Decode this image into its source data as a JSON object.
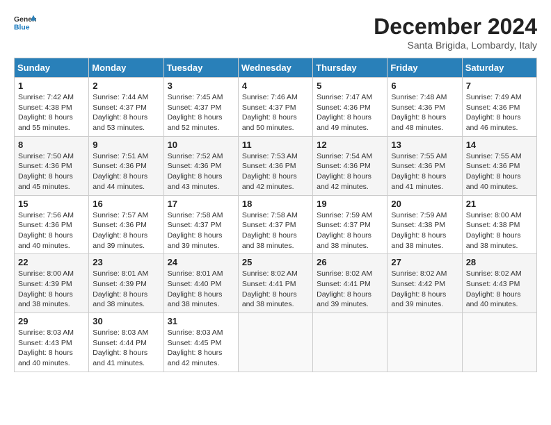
{
  "header": {
    "logo_line1": "General",
    "logo_line2": "Blue",
    "month_year": "December 2024",
    "location": "Santa Brigida, Lombardy, Italy"
  },
  "days_of_week": [
    "Sunday",
    "Monday",
    "Tuesday",
    "Wednesday",
    "Thursday",
    "Friday",
    "Saturday"
  ],
  "weeks": [
    [
      {
        "day": "1",
        "sunrise": "7:42 AM",
        "sunset": "4:38 PM",
        "daylight": "8 hours and 55 minutes."
      },
      {
        "day": "2",
        "sunrise": "7:44 AM",
        "sunset": "4:37 PM",
        "daylight": "8 hours and 53 minutes."
      },
      {
        "day": "3",
        "sunrise": "7:45 AM",
        "sunset": "4:37 PM",
        "daylight": "8 hours and 52 minutes."
      },
      {
        "day": "4",
        "sunrise": "7:46 AM",
        "sunset": "4:37 PM",
        "daylight": "8 hours and 50 minutes."
      },
      {
        "day": "5",
        "sunrise": "7:47 AM",
        "sunset": "4:36 PM",
        "daylight": "8 hours and 49 minutes."
      },
      {
        "day": "6",
        "sunrise": "7:48 AM",
        "sunset": "4:36 PM",
        "daylight": "8 hours and 48 minutes."
      },
      {
        "day": "7",
        "sunrise": "7:49 AM",
        "sunset": "4:36 PM",
        "daylight": "8 hours and 46 minutes."
      }
    ],
    [
      {
        "day": "8",
        "sunrise": "7:50 AM",
        "sunset": "4:36 PM",
        "daylight": "8 hours and 45 minutes."
      },
      {
        "day": "9",
        "sunrise": "7:51 AM",
        "sunset": "4:36 PM",
        "daylight": "8 hours and 44 minutes."
      },
      {
        "day": "10",
        "sunrise": "7:52 AM",
        "sunset": "4:36 PM",
        "daylight": "8 hours and 43 minutes."
      },
      {
        "day": "11",
        "sunrise": "7:53 AM",
        "sunset": "4:36 PM",
        "daylight": "8 hours and 42 minutes."
      },
      {
        "day": "12",
        "sunrise": "7:54 AM",
        "sunset": "4:36 PM",
        "daylight": "8 hours and 42 minutes."
      },
      {
        "day": "13",
        "sunrise": "7:55 AM",
        "sunset": "4:36 PM",
        "daylight": "8 hours and 41 minutes."
      },
      {
        "day": "14",
        "sunrise": "7:55 AM",
        "sunset": "4:36 PM",
        "daylight": "8 hours and 40 minutes."
      }
    ],
    [
      {
        "day": "15",
        "sunrise": "7:56 AM",
        "sunset": "4:36 PM",
        "daylight": "8 hours and 40 minutes."
      },
      {
        "day": "16",
        "sunrise": "7:57 AM",
        "sunset": "4:36 PM",
        "daylight": "8 hours and 39 minutes."
      },
      {
        "day": "17",
        "sunrise": "7:58 AM",
        "sunset": "4:37 PM",
        "daylight": "8 hours and 39 minutes."
      },
      {
        "day": "18",
        "sunrise": "7:58 AM",
        "sunset": "4:37 PM",
        "daylight": "8 hours and 38 minutes."
      },
      {
        "day": "19",
        "sunrise": "7:59 AM",
        "sunset": "4:37 PM",
        "daylight": "8 hours and 38 minutes."
      },
      {
        "day": "20",
        "sunrise": "7:59 AM",
        "sunset": "4:38 PM",
        "daylight": "8 hours and 38 minutes."
      },
      {
        "day": "21",
        "sunrise": "8:00 AM",
        "sunset": "4:38 PM",
        "daylight": "8 hours and 38 minutes."
      }
    ],
    [
      {
        "day": "22",
        "sunrise": "8:00 AM",
        "sunset": "4:39 PM",
        "daylight": "8 hours and 38 minutes."
      },
      {
        "day": "23",
        "sunrise": "8:01 AM",
        "sunset": "4:39 PM",
        "daylight": "8 hours and 38 minutes."
      },
      {
        "day": "24",
        "sunrise": "8:01 AM",
        "sunset": "4:40 PM",
        "daylight": "8 hours and 38 minutes."
      },
      {
        "day": "25",
        "sunrise": "8:02 AM",
        "sunset": "4:41 PM",
        "daylight": "8 hours and 38 minutes."
      },
      {
        "day": "26",
        "sunrise": "8:02 AM",
        "sunset": "4:41 PM",
        "daylight": "8 hours and 39 minutes."
      },
      {
        "day": "27",
        "sunrise": "8:02 AM",
        "sunset": "4:42 PM",
        "daylight": "8 hours and 39 minutes."
      },
      {
        "day": "28",
        "sunrise": "8:02 AM",
        "sunset": "4:43 PM",
        "daylight": "8 hours and 40 minutes."
      }
    ],
    [
      {
        "day": "29",
        "sunrise": "8:03 AM",
        "sunset": "4:43 PM",
        "daylight": "8 hours and 40 minutes."
      },
      {
        "day": "30",
        "sunrise": "8:03 AM",
        "sunset": "4:44 PM",
        "daylight": "8 hours and 41 minutes."
      },
      {
        "day": "31",
        "sunrise": "8:03 AM",
        "sunset": "4:45 PM",
        "daylight": "8 hours and 42 minutes."
      },
      null,
      null,
      null,
      null
    ]
  ],
  "labels": {
    "sunrise": "Sunrise:",
    "sunset": "Sunset:",
    "daylight": "Daylight:"
  }
}
